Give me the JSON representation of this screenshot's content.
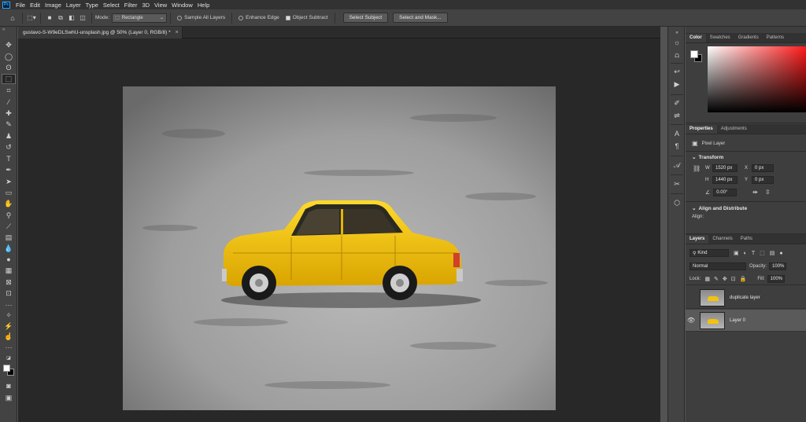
{
  "menubar": {
    "logo": "Ps",
    "items": [
      "File",
      "Edit",
      "Image",
      "Layer",
      "Type",
      "Select",
      "Filter",
      "3D",
      "View",
      "Window",
      "Help"
    ]
  },
  "options_bar": {
    "mode_label": "Mode:",
    "mode_value": "Rectangle",
    "sample_all_layers": "Sample All Layers",
    "enhance_edge": "Enhance Edge",
    "object_subtract": "Object Subtract",
    "select_subject": "Select Subject",
    "select_and_mask": "Select and Mask..."
  },
  "document": {
    "tab_title": "gustavo-S-W9eDLSwhU-unsplash.jpg @ 50% (Layer 0, RGB/8) *",
    "close_glyph": "×"
  },
  "color_panel": {
    "tabs": [
      "Color",
      "Swatches",
      "Gradients",
      "Patterns"
    ],
    "active_tab": "Color"
  },
  "properties_panel": {
    "tabs": [
      "Properties",
      "Adjustments"
    ],
    "active_tab": "Properties",
    "layer_type": "Pixel Layer",
    "transform_title": "Transform",
    "w_label": "W",
    "w_value": "1520 px",
    "h_label": "H",
    "h_value": "1440 px",
    "x_label": "X",
    "x_value": "0 px",
    "y_label": "Y",
    "y_value": "0 px",
    "angle_value": "0.00°",
    "align_title": "Align and Distribute",
    "align_label": "Align:"
  },
  "layers_panel": {
    "tabs": [
      "Layers",
      "Channels",
      "Paths"
    ],
    "active_tab": "Layers",
    "kind_label": "Kind",
    "blend_mode": "Normal",
    "opacity_label": "Opacity:",
    "opacity_value": "100%",
    "lock_label": "Lock:",
    "fill_label": "Fill:",
    "fill_value": "100%",
    "layers": [
      {
        "name": "duplicate layer",
        "visible": false,
        "selected": false
      },
      {
        "name": "Layer 0",
        "visible": true,
        "selected": true
      }
    ]
  },
  "colors": {
    "accent_ps": "#31a8ff",
    "annotation_arrow": "#e02020",
    "car_yellow": "#f2c30c"
  }
}
